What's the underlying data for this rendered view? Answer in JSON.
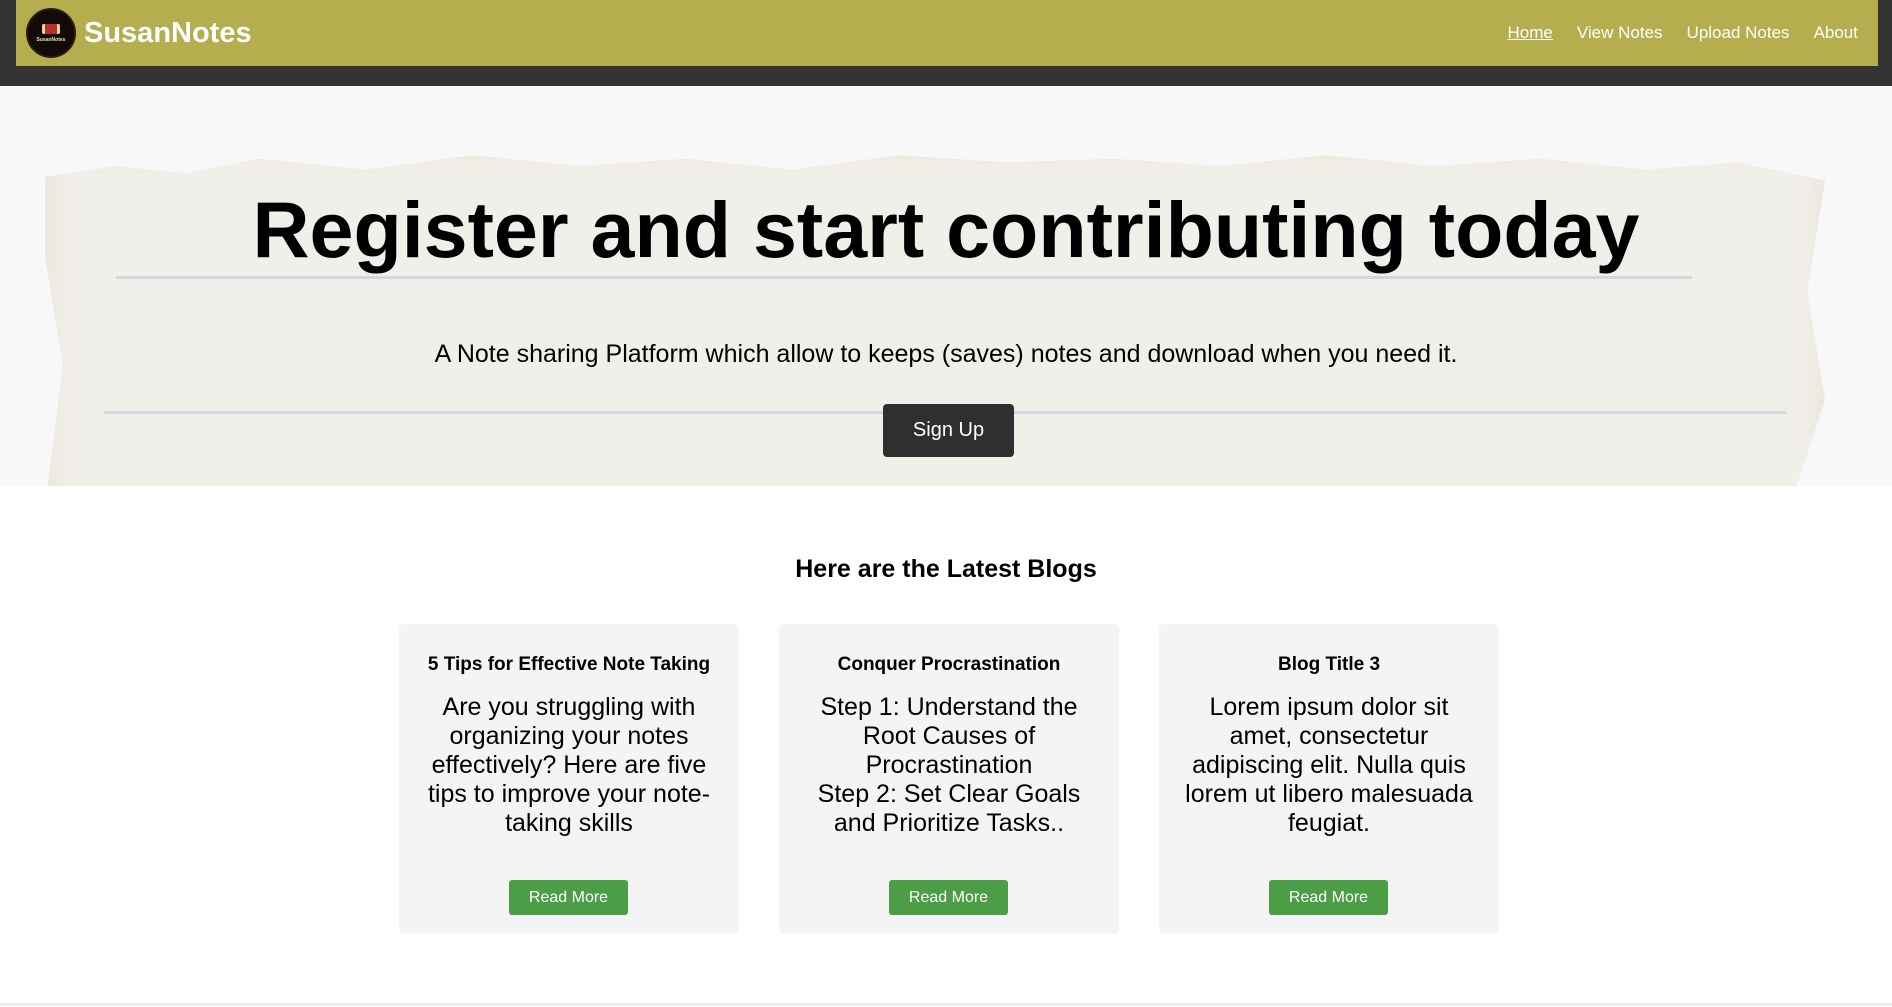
{
  "header": {
    "brand": "SusanNotes",
    "logo_text": "SusanNotes",
    "nav": [
      {
        "label": "Home",
        "active": true
      },
      {
        "label": "View Notes",
        "active": false
      },
      {
        "label": "Upload Notes",
        "active": false
      },
      {
        "label": "About",
        "active": false
      }
    ]
  },
  "hero": {
    "title": "Register and start contributing today",
    "subtitle": "A Note sharing Platform which allow to keeps (saves) notes and download when you need it.",
    "signup_label": "Sign Up"
  },
  "blogs": {
    "heading": "Here are the Latest Blogs",
    "cards": [
      {
        "title": "5 Tips for Effective Note Taking",
        "text": "Are you struggling with organizing your notes effectively? Here are five tips to improve your note-taking skills",
        "button": "Read More"
      },
      {
        "title": "Conquer Procrastination",
        "text_lines": [
          "Step 1: Understand the Root Causes of Procrastination",
          "Step 2: Set Clear Goals and Prioritize Tasks.."
        ],
        "button": "Read More"
      },
      {
        "title": "Blog Title 3",
        "text": "Lorem ipsum dolor sit amet, consectetur adipiscing elit. Nulla quis lorem ut libero malesuada feugiat.",
        "button": "Read More"
      }
    ]
  },
  "colors": {
    "navbar": "#b5ae4e",
    "topband": "#333333",
    "signup_button": "#2f2f2f",
    "read_more_button": "#4b9d46",
    "card_background": "#f4f4f4"
  }
}
